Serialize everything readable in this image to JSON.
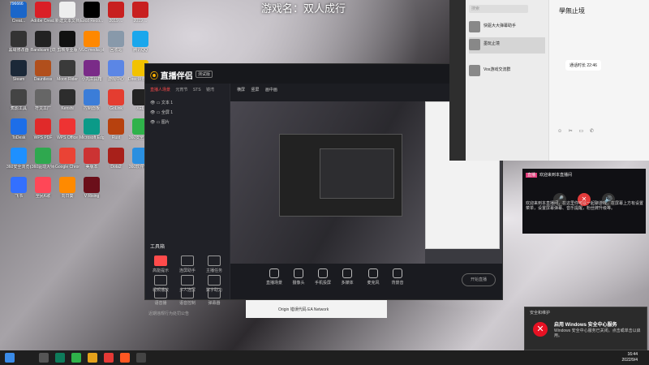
{
  "overlay_title": "游戏名：双人成行",
  "desktop_icons": [
    {
      "label": "Creat...",
      "badge": "796666",
      "color": "#1b66c9"
    },
    {
      "label": "Adobe Creat...",
      "color": "#da1f26"
    },
    {
      "label": "新建文本文档",
      "color": "#eeeeee"
    },
    {
      "label": "Ezcd Reco...",
      "color": "#000000"
    },
    {
      "label": "2019 ...",
      "color": "#c82020"
    },
    {
      "label": "2019 ...",
      "color": "#c82020"
    },
    {
      "label": "黑域修改器",
      "color": "#333333"
    },
    {
      "label": "Bandicam (双击...",
      "color": "#222222"
    },
    {
      "label": "剪映专业版",
      "color": "#111111"
    },
    {
      "label": "VLC media player",
      "color": "#ff8800"
    },
    {
      "label": "回收站",
      "color": "#8899aa"
    },
    {
      "label": "腾讯QQ",
      "color": "#1aa7ec"
    },
    {
      "label": "Steam",
      "color": "#1b2838"
    },
    {
      "label": "Dauntless",
      "color": "#b14f1c"
    },
    {
      "label": "Moon Rider",
      "color": "#3a3a3a"
    },
    {
      "label": "小丸工具箱",
      "color": "#7a2b88"
    },
    {
      "label": "游戏中心",
      "color": "#5b86e5"
    },
    {
      "label": "DirectX修复工具",
      "color": "#f2c200"
    },
    {
      "label": "蕉影工具",
      "color": "#444444"
    },
    {
      "label": "符文工厂",
      "color": "#666666"
    },
    {
      "label": "Kenshi",
      "color": "#2d2d2d"
    },
    {
      "label": "控制面板",
      "color": "#3b7dd8"
    },
    {
      "label": "GoLink",
      "color": "#e43d30"
    },
    {
      "label": "XEL",
      "color": "#222222"
    },
    {
      "label": "ToDesk",
      "color": "#1d6ee8"
    },
    {
      "label": "WPS PDF",
      "color": "#e02a2a"
    },
    {
      "label": "WPS Office",
      "color": "#ee3333"
    },
    {
      "label": "Microsoft Edge",
      "color": "#0b9a88"
    },
    {
      "label": "Rust",
      "color": "#b7410e"
    },
    {
      "label": "360安全卫士",
      "color": "#2fb24a"
    },
    {
      "label": "360安全浏览器",
      "color": "#1e90ff"
    },
    {
      "label": "360驱动大师",
      "color": "#2fa84f"
    },
    {
      "label": "Google Chrome",
      "color": "#ea4335"
    },
    {
      "label": "美版本",
      "color": "#cc3333"
    },
    {
      "label": "Dota2",
      "color": "#a8201a"
    },
    {
      "label": "360软件管家",
      "color": "#2a8fe0"
    },
    {
      "label": "飞书",
      "color": "#3370ff"
    },
    {
      "label": "全民K歌",
      "color": "#ff4757"
    },
    {
      "label": "向日葵",
      "color": "#ff8a00"
    },
    {
      "label": "V Rising",
      "color": "#6b0f1a"
    }
  ],
  "app": {
    "logo": "直播伴侣",
    "beta": "测试版",
    "tabs": [
      "直播人场景",
      "元宵节",
      "STS",
      "镜湾"
    ],
    "sources": [
      "文本 1",
      "全屏 1",
      "图片"
    ],
    "toolbox_title": "工具箱",
    "tools": [
      "高能提示",
      "连屏助手",
      "主播任务",
      "视频播放",
      "多人连屏",
      "数字助力",
      "语音播",
      "语音控制",
      "弹幕器"
    ],
    "subtabs": [
      "横屏",
      "竖屏",
      "画中画"
    ],
    "dock": [
      "直播场景",
      "摄像头",
      "手机投屏",
      "多媒体",
      "麦克风",
      "背景音"
    ],
    "start_label": "开始直播",
    "notice": "近期违规行为处罚公告"
  },
  "chat": {
    "search_placeholder": "搜索",
    "contacts": [
      "快驱大大弹幕助手",
      "墨玩止境",
      "Vos游戏交流群"
    ],
    "title": "學無止境",
    "bubble": "通话时长 22:46"
  },
  "live_popup": {
    "tag": "直播",
    "header": "欢迎来到本直播间",
    "text": "欢迎来到本直播间，在这里你可以一起聊游戏，在屏幕上方有设置菜单，设置屏幕弹幕、音乐提醒，粉丝牌升级等。"
  },
  "security_toast": {
    "header": "安全和维护",
    "title": "启用 Windows 安全中心服务",
    "body": "Windows 安全中心服务已关闭。点击或单击以启用。"
  },
  "origin_bar": "Origin 错误代码 EA Network",
  "taskbar": {
    "time": "16:44",
    "date": "2022/9/4"
  }
}
